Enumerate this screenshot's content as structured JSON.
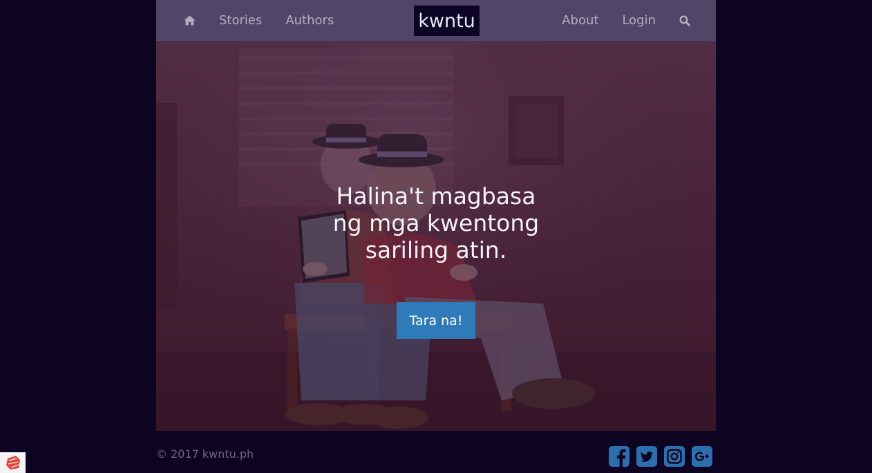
{
  "nav": {
    "left_items": [
      {
        "icon": "home-icon"
      },
      {
        "label": "Stories"
      },
      {
        "label": "Authors"
      }
    ],
    "brand": "kwntu",
    "right_items": [
      {
        "label": "About"
      },
      {
        "label": "Login"
      },
      {
        "icon": "search-icon"
      }
    ]
  },
  "hero": {
    "heading_lines": [
      "Halina't magbasa",
      "ng mga kwentong",
      "sariling atin."
    ],
    "cta_label": "Tara na!"
  },
  "footer": {
    "copyright": "© 2017 kwntu.ph",
    "social_icons": [
      "facebook-icon",
      "twitter-icon",
      "instagram-icon",
      "google-plus-icon"
    ]
  },
  "colors": {
    "page_background": "#0c0420",
    "navbar": "#524668",
    "brand_background": "#0d0526",
    "cta": "#2f7ab9",
    "social": "#2b6fae",
    "nav_text": "#b4acc3"
  }
}
